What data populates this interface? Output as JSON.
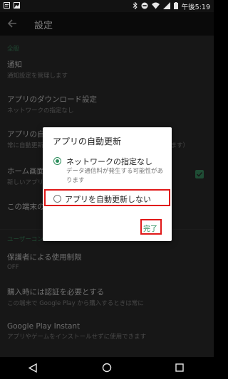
{
  "status_bar": {
    "time": "午後5:19",
    "icons": [
      "notification-icon",
      "image-icon",
      "bluetooth-icon",
      "do-not-disturb-icon",
      "wifi-icon",
      "signal-icon",
      "battery-icon"
    ]
  },
  "app_bar": {
    "title": "設定",
    "back_icon": "arrow-back-icon"
  },
  "sections": {
    "general": "全般",
    "user_controls": "ユーザーコントロール"
  },
  "settings": [
    {
      "title": "通知",
      "subtitle": "通知設定を管理します"
    },
    {
      "title": "アプリのダウンロード設定",
      "subtitle": "ネットワークの指定なし"
    },
    {
      "title": "アプリの自動更新",
      "subtitle": "常に自動更新します（データ通信料が発生する可能性があります）"
    },
    {
      "title": "ホーム画面にアイコンを追加",
      "subtitle": "新しいアプリ"
    },
    {
      "title": "この端末の検索履歴を消去",
      "subtitle": ""
    },
    {
      "title": "保護者による使用制限",
      "subtitle": "OFF"
    },
    {
      "title": "購入時には認証を必要とする",
      "subtitle": "この端末で Google Play から購入するときは常に"
    },
    {
      "title": "Google Play Instant",
      "subtitle": "アプリやゲームをインストールせずに使用できます"
    }
  ],
  "home_icon_checkbox_checked": true,
  "dialog": {
    "title": "アプリの自動更新",
    "options": [
      {
        "label": "ネットワークの指定なし",
        "description": "データ通信料が発生する可能性があります",
        "selected": true
      },
      {
        "label": "アプリを自動更新しない",
        "selected": false
      }
    ],
    "done_label": "完了"
  },
  "colors": {
    "accent": "#2f8f5e",
    "highlight": "#e01818",
    "background": "#2e2e2e"
  }
}
